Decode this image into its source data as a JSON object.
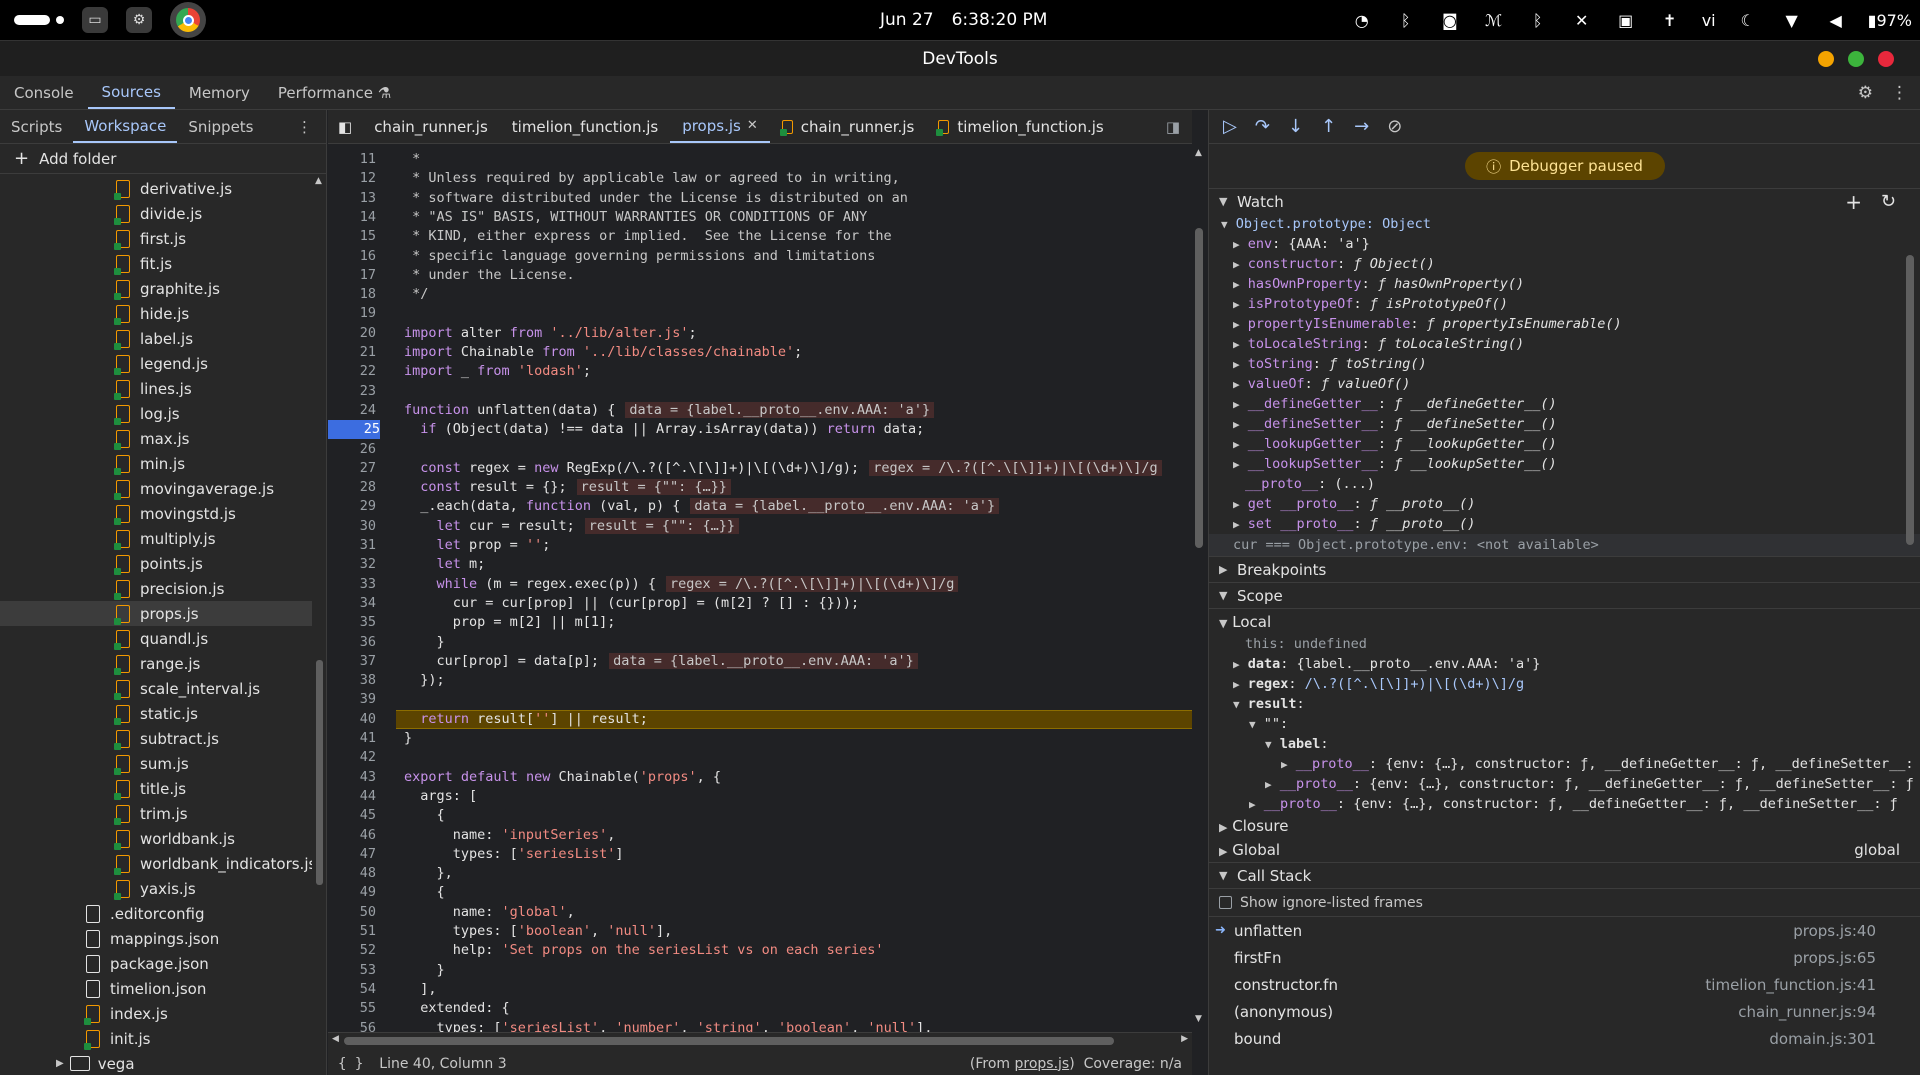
{
  "system": {
    "date": "Jun 27",
    "time": "6:38:20 PM",
    "lang": "vi",
    "battery": "97%"
  },
  "window": {
    "title": "DevTools"
  },
  "main_tabs": [
    {
      "label": "Console"
    },
    {
      "label": "Sources"
    },
    {
      "label": "Memory"
    },
    {
      "label": "Performance"
    }
  ],
  "navigator": {
    "tabs": [
      {
        "label": "Scripts"
      },
      {
        "label": "Workspace"
      },
      {
        "label": "Snippets"
      }
    ],
    "add_folder": "Add folder",
    "files": [
      {
        "name": "derivative.js",
        "kind": "js"
      },
      {
        "name": "divide.js",
        "kind": "js"
      },
      {
        "name": "first.js",
        "kind": "js"
      },
      {
        "name": "fit.js",
        "kind": "js"
      },
      {
        "name": "graphite.js",
        "kind": "js"
      },
      {
        "name": "hide.js",
        "kind": "js"
      },
      {
        "name": "label.js",
        "kind": "js"
      },
      {
        "name": "legend.js",
        "kind": "js"
      },
      {
        "name": "lines.js",
        "kind": "js"
      },
      {
        "name": "log.js",
        "kind": "js"
      },
      {
        "name": "max.js",
        "kind": "js"
      },
      {
        "name": "min.js",
        "kind": "js"
      },
      {
        "name": "movingaverage.js",
        "kind": "js"
      },
      {
        "name": "movingstd.js",
        "kind": "js"
      },
      {
        "name": "multiply.js",
        "kind": "js"
      },
      {
        "name": "points.js",
        "kind": "js"
      },
      {
        "name": "precision.js",
        "kind": "js"
      },
      {
        "name": "props.js",
        "kind": "js",
        "selected": true
      },
      {
        "name": "quandl.js",
        "kind": "js"
      },
      {
        "name": "range.js",
        "kind": "js"
      },
      {
        "name": "scale_interval.js",
        "kind": "js"
      },
      {
        "name": "static.js",
        "kind": "js"
      },
      {
        "name": "subtract.js",
        "kind": "js"
      },
      {
        "name": "sum.js",
        "kind": "js"
      },
      {
        "name": "title.js",
        "kind": "js"
      },
      {
        "name": "trim.js",
        "kind": "js"
      },
      {
        "name": "worldbank.js",
        "kind": "js"
      },
      {
        "name": "worldbank_indicators.js",
        "kind": "js"
      },
      {
        "name": "yaxis.js",
        "kind": "js"
      },
      {
        "name": ".editorconfig",
        "kind": "plain",
        "shallow": true
      },
      {
        "name": "mappings.json",
        "kind": "plain",
        "shallow": true
      },
      {
        "name": "package.json",
        "kind": "plain",
        "shallow": true
      },
      {
        "name": "timelion.json",
        "kind": "plain",
        "shallow": true
      },
      {
        "name": "index.js",
        "kind": "js",
        "shallow": true
      },
      {
        "name": "init.js",
        "kind": "js",
        "shallow": true
      },
      {
        "name": "vega",
        "kind": "folder"
      }
    ]
  },
  "editor": {
    "tabs": [
      {
        "label": "chain_runner.js"
      },
      {
        "label": "timelion_function.js"
      },
      {
        "label": "props.js",
        "active": true,
        "close": "✕"
      },
      {
        "label": "chain_runner.js",
        "file_icon": true
      },
      {
        "label": "timelion_function.js",
        "file_icon": true
      }
    ],
    "lines": [
      {
        "n": 11,
        "t": " *"
      },
      {
        "n": 12,
        "t": " * Unless required by applicable law or agreed to in writing,"
      },
      {
        "n": 13,
        "t": " * software distributed under the License is distributed on an"
      },
      {
        "n": 14,
        "t": " * \"AS IS\" BASIS, WITHOUT WARRANTIES OR CONDITIONS OF ANY"
      },
      {
        "n": 15,
        "t": " * KIND, either express or implied.  See the License for the"
      },
      {
        "n": 16,
        "t": " * specific language governing permissions and limitations"
      },
      {
        "n": 17,
        "t": " * under the License."
      },
      {
        "n": 18,
        "t": " */"
      },
      {
        "n": 19,
        "t": ""
      },
      {
        "n": 20,
        "t": "import alter from '../lib/alter.js';"
      },
      {
        "n": 21,
        "t": "import Chainable from '../lib/classes/chainable';"
      },
      {
        "n": 22,
        "t": "import _ from 'lodash';"
      },
      {
        "n": 23,
        "t": ""
      },
      {
        "n": 24,
        "t": "function unflatten(data) {",
        "inline": "data = {label.__proto__.env.AAA: 'a'}"
      },
      {
        "n": 25,
        "t": "  if (Object(data) !== data || Array.isArray(data)) return data;",
        "breakpoint": true
      },
      {
        "n": 26,
        "t": ""
      },
      {
        "n": 27,
        "t": "  const regex = new RegExp(/\\.?([^.\\[\\]]+)|\\[(\\d+)\\]/g);",
        "inline": "regex = /\\.?([^.\\[\\]]+)|\\[(\\d+)\\]/g"
      },
      {
        "n": 28,
        "t": "  const result = {};",
        "inline": "result = {\"\": {…}}"
      },
      {
        "n": 29,
        "t": "  _.each(data, function (val, p) {",
        "inline": "data = {label.__proto__.env.AAA: 'a'}"
      },
      {
        "n": 30,
        "t": "    let cur = result;",
        "inline": "result = {\"\": {…}}"
      },
      {
        "n": 31,
        "t": "    let prop = '';"
      },
      {
        "n": 32,
        "t": "    let m;"
      },
      {
        "n": 33,
        "t": "    while (m = regex.exec(p)) {",
        "inline": "regex = /\\.?([^.\\[\\]]+)|\\[(\\d+)\\]/g"
      },
      {
        "n": 34,
        "t": "      cur = cur[prop] || (cur[prop] = (m[2] ? [] : {}));"
      },
      {
        "n": 35,
        "t": "      prop = m[2] || m[1];"
      },
      {
        "n": 36,
        "t": "    }"
      },
      {
        "n": 37,
        "t": "    cur[prop] = data[p];",
        "inline": "data = {label.__proto__.env.AAA: 'a'}"
      },
      {
        "n": 38,
        "t": "  });"
      },
      {
        "n": 39,
        "t": ""
      },
      {
        "n": 40,
        "t": "  return result[''] || result;",
        "current": true
      },
      {
        "n": 41,
        "t": "}"
      },
      {
        "n": 42,
        "t": ""
      },
      {
        "n": 43,
        "t": "export default new Chainable('props', {"
      },
      {
        "n": 44,
        "t": "  args: ["
      },
      {
        "n": 45,
        "t": "    {"
      },
      {
        "n": 46,
        "t": "      name: 'inputSeries',"
      },
      {
        "n": 47,
        "t": "      types: ['seriesList']"
      },
      {
        "n": 48,
        "t": "    },"
      },
      {
        "n": 49,
        "t": "    {"
      },
      {
        "n": 50,
        "t": "      name: 'global',"
      },
      {
        "n": 51,
        "t": "      types: ['boolean', 'null'],"
      },
      {
        "n": 52,
        "t": "      help: 'Set props on the seriesList vs on each series'"
      },
      {
        "n": 53,
        "t": "    }"
      },
      {
        "n": 54,
        "t": "  ],"
      },
      {
        "n": 55,
        "t": "  extended: {"
      },
      {
        "n": 56,
        "t": "    types: ['seriesList', 'number', 'string', 'boolean', 'null'],"
      }
    ],
    "status_position": "Line 40, Column 3",
    "status_from_prefix": "(From ",
    "status_from_file": "props.js",
    "status_from_suffix": ")",
    "status_coverage": "Coverage: n/a"
  },
  "debugger": {
    "paused_label": "Debugger paused",
    "watch_title": "Watch",
    "watch_root": "Object.prototype: Object",
    "watch_props": [
      {
        "key": "env",
        "val": "{AAA: 'a'}"
      },
      {
        "key": "constructor",
        "val": "ƒ Object()"
      },
      {
        "key": "hasOwnProperty",
        "val": "ƒ hasOwnProperty()"
      },
      {
        "key": "isPrototypeOf",
        "val": "ƒ isPrototypeOf()"
      },
      {
        "key": "propertyIsEnumerable",
        "val": "ƒ propertyIsEnumerable()"
      },
      {
        "key": "toLocaleString",
        "val": "ƒ toLocaleString()"
      },
      {
        "key": "toString",
        "val": "ƒ toString()"
      },
      {
        "key": "valueOf",
        "val": "ƒ valueOf()"
      },
      {
        "key": "__defineGetter__",
        "val": "ƒ __defineGetter__()"
      },
      {
        "key": "__defineSetter__",
        "val": "ƒ __defineSetter__()"
      },
      {
        "key": "__lookupGetter__",
        "val": "ƒ __lookupGetter__()"
      },
      {
        "key": "__lookupSetter__",
        "val": "ƒ __lookupSetter__()"
      },
      {
        "key": "__proto__",
        "val": "(...)",
        "noarrow": true
      },
      {
        "key": "get __proto__",
        "val": "ƒ __proto__()"
      },
      {
        "key": "set __proto__",
        "val": "ƒ __proto__()"
      }
    ],
    "watch_expr2": "cur === Object.prototype.env: <not available>",
    "breakpoints_title": "Breakpoints",
    "scope_title": "Scope",
    "local_title": "Local",
    "scope_this_key": "this",
    "scope_this_val": "undefined",
    "scope_data_key": "data",
    "scope_data_val": "{label.__proto__.env.AAA: 'a'}",
    "scope_regex_key": "regex",
    "scope_regex_val": "/\\.?([^.\\[\\]]+)|\\[(\\d+)\\]/g",
    "scope_result_key": "result",
    "scope_empty_key": "\"\"",
    "scope_label_key": "label",
    "scope_proto_key": "__proto__",
    "scope_proto_val": "{env: {…}, constructor: ƒ, __defineGetter__: ƒ, __defineSetter__: ƒ",
    "closure_title": "Closure",
    "global_title": "Global",
    "global_value": "global",
    "callstack_title": "Call Stack",
    "show_ignore": "Show ignore-listed frames",
    "frames": [
      {
        "fn": "unflatten",
        "loc": "props.js:40",
        "current": true
      },
      {
        "fn": "firstFn",
        "loc": "props.js:65"
      },
      {
        "fn": "constructor.fn",
        "loc": "timelion_function.js:41"
      },
      {
        "fn": "(anonymous)",
        "loc": "chain_runner.js:94"
      },
      {
        "fn": "bound",
        "loc": "domain.js:301"
      }
    ]
  },
  "colors": {
    "accent": "#a8c7fa",
    "paused_bg": "#5c4400",
    "breakpoint": "#3c6de0"
  }
}
